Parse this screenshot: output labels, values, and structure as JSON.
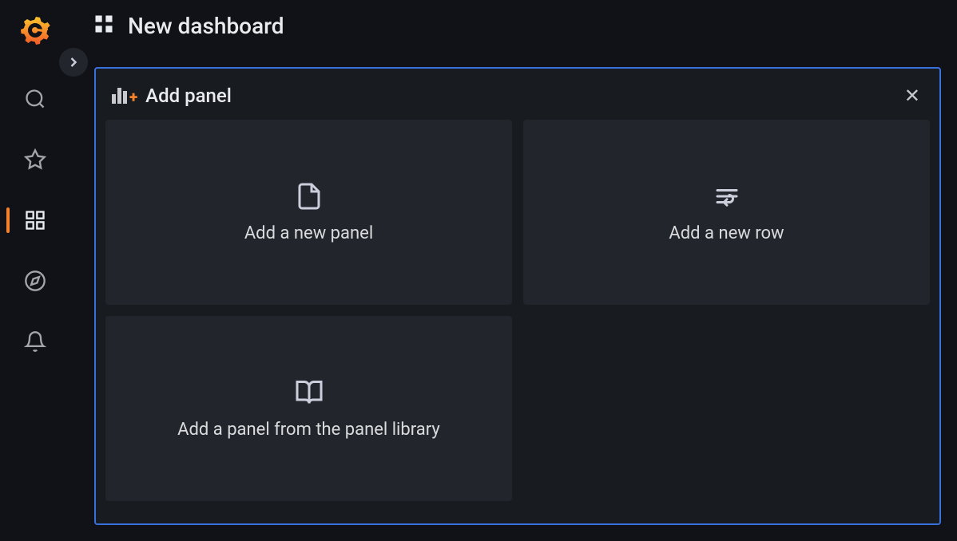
{
  "header": {
    "title": "New dashboard"
  },
  "sidebar": {
    "items": [
      {
        "id": "search"
      },
      {
        "id": "starred"
      },
      {
        "id": "dashboards",
        "active": true
      },
      {
        "id": "explore"
      },
      {
        "id": "alerting"
      }
    ]
  },
  "panel": {
    "title": "Add panel",
    "options": [
      {
        "id": "new-panel",
        "label": "Add a new panel",
        "icon": "file"
      },
      {
        "id": "new-row",
        "label": "Add a new row",
        "icon": "row"
      },
      {
        "id": "panel-library",
        "label": "Add a panel from the panel library",
        "icon": "book"
      }
    ]
  }
}
